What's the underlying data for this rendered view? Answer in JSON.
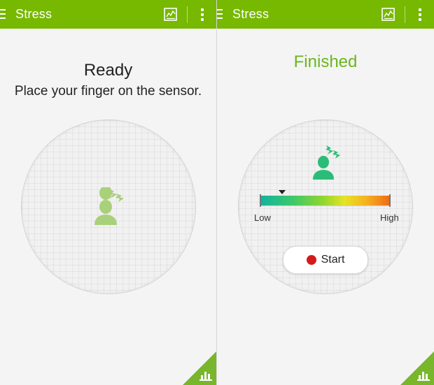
{
  "app": {
    "title": "Stress"
  },
  "left_screen": {
    "title": "Stress",
    "status": "Ready",
    "instruction": "Place your finger on the sensor."
  },
  "right_screen": {
    "title": "Stress",
    "status": "Finished",
    "gauge": {
      "low_label": "Low",
      "high_label": "High",
      "level": 0.17
    },
    "start_button": "Start"
  },
  "icons": {
    "menu": "menu-icon",
    "history": "chart-icon",
    "overflow": "overflow-menu-icon",
    "stress_head": "stressed-head-icon",
    "corner": "bar-chart-icon"
  },
  "colors": {
    "action_bar": "#77b800",
    "finished_text": "#6bb620",
    "head_ready": "#a9d07a",
    "head_finished": "#2bbd77",
    "record_dot": "#d41b1b",
    "corner_tab": "#78b62b"
  }
}
